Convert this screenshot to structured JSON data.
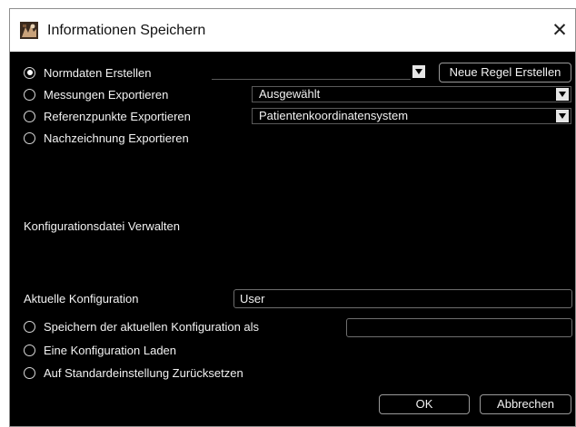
{
  "window": {
    "title": "Informationen Speichern",
    "close_glyph": "✕",
    "app_icon": "app-icon"
  },
  "export": {
    "options": [
      {
        "label": "Normdaten Erstellen",
        "checked": true
      },
      {
        "label": "Messungen Exportieren",
        "checked": false
      },
      {
        "label": "Referenzpunkte Exportieren",
        "checked": false
      },
      {
        "label": "Nachzeichnung Exportieren",
        "checked": false
      }
    ],
    "norm_select_value": "",
    "new_rule_button": "Neue Regel Erstellen",
    "measurements_select_value": "Ausgewählt",
    "reference_select_value": "Patientenkoordinatensystem"
  },
  "config": {
    "section_title": "Konfigurationsdatei Verwalten",
    "current_label": "Aktuelle Konfiguration",
    "current_value": "User",
    "options": [
      {
        "label": "Speichern der aktuellen Konfiguration als",
        "checked": false
      },
      {
        "label": "Eine Konfiguration Laden",
        "checked": false
      },
      {
        "label": "Auf Standardeinstellung Zurücksetzen",
        "checked": false
      }
    ],
    "save_as_value": ""
  },
  "footer": {
    "ok_label": "OK",
    "cancel_label": "Abbrechen"
  },
  "colors": {
    "background": "#000000",
    "titlebar": "#ffffff",
    "text": "#f2f2f2",
    "border": "#9a9a9a"
  }
}
